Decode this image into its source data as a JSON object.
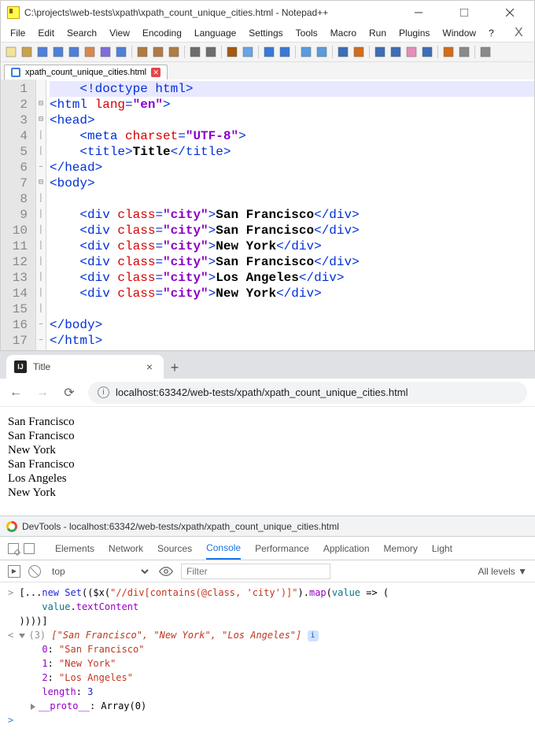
{
  "notepadpp": {
    "title": "C:\\projects\\web-tests\\xpath\\xpath_count_unique_cities.html - Notepad++",
    "menu": [
      "File",
      "Edit",
      "Search",
      "View",
      "Encoding",
      "Language",
      "Settings",
      "Tools",
      "Macro",
      "Run",
      "Plugins",
      "Window",
      "?"
    ],
    "extra_close": "X",
    "tab": {
      "name": "xpath_count_unique_cities.html"
    },
    "code": {
      "lines": [
        {
          "n": 1,
          "hl": true,
          "fold": "",
          "tokens": [
            {
              "txt": "    ",
              "cls": ""
            },
            {
              "txt": "<!doctype html>",
              "cls": "c-blue"
            }
          ]
        },
        {
          "n": 2,
          "fold": "⊟",
          "tokens": [
            {
              "txt": "<html ",
              "cls": "c-blue"
            },
            {
              "txt": "lang",
              "cls": "c-red"
            },
            {
              "txt": "=",
              "cls": "c-blue"
            },
            {
              "txt": "\"en\"",
              "cls": "c-purple bold"
            },
            {
              "txt": ">",
              "cls": "c-blue"
            }
          ]
        },
        {
          "n": 3,
          "fold": "⊟",
          "tokens": [
            {
              "txt": "<head>",
              "cls": "c-blue"
            }
          ]
        },
        {
          "n": 4,
          "fold": "│",
          "tokens": [
            {
              "txt": "    ",
              "cls": ""
            },
            {
              "txt": "<meta ",
              "cls": "c-blue"
            },
            {
              "txt": "charset",
              "cls": "c-red"
            },
            {
              "txt": "=",
              "cls": "c-blue"
            },
            {
              "txt": "\"UTF-8\"",
              "cls": "c-purple bold"
            },
            {
              "txt": ">",
              "cls": "c-blue"
            }
          ]
        },
        {
          "n": 5,
          "fold": "│",
          "tokens": [
            {
              "txt": "    ",
              "cls": ""
            },
            {
              "txt": "<title>",
              "cls": "c-blue"
            },
            {
              "txt": "Title",
              "cls": "c-black bold"
            },
            {
              "txt": "</title>",
              "cls": "c-blue"
            }
          ]
        },
        {
          "n": 6,
          "fold": "–",
          "tokens": [
            {
              "txt": "</head>",
              "cls": "c-blue"
            }
          ]
        },
        {
          "n": 7,
          "fold": "⊟",
          "tokens": [
            {
              "txt": "<body>",
              "cls": "c-blue"
            }
          ]
        },
        {
          "n": 8,
          "fold": "│",
          "tokens": [
            {
              "txt": "",
              "cls": ""
            }
          ]
        },
        {
          "n": 9,
          "fold": "│",
          "tokens": [
            {
              "txt": "    ",
              "cls": ""
            },
            {
              "txt": "<div ",
              "cls": "c-blue"
            },
            {
              "txt": "class",
              "cls": "c-red"
            },
            {
              "txt": "=",
              "cls": "c-blue"
            },
            {
              "txt": "\"city\"",
              "cls": "c-purple bold"
            },
            {
              "txt": ">",
              "cls": "c-blue"
            },
            {
              "txt": "San Francisco",
              "cls": "c-black bold"
            },
            {
              "txt": "</div>",
              "cls": "c-blue"
            }
          ]
        },
        {
          "n": 10,
          "fold": "│",
          "tokens": [
            {
              "txt": "    ",
              "cls": ""
            },
            {
              "txt": "<div ",
              "cls": "c-blue"
            },
            {
              "txt": "class",
              "cls": "c-red"
            },
            {
              "txt": "=",
              "cls": "c-blue"
            },
            {
              "txt": "\"city\"",
              "cls": "c-purple bold"
            },
            {
              "txt": ">",
              "cls": "c-blue"
            },
            {
              "txt": "San Francisco",
              "cls": "c-black bold"
            },
            {
              "txt": "</div>",
              "cls": "c-blue"
            }
          ]
        },
        {
          "n": 11,
          "fold": "│",
          "tokens": [
            {
              "txt": "    ",
              "cls": ""
            },
            {
              "txt": "<div ",
              "cls": "c-blue"
            },
            {
              "txt": "class",
              "cls": "c-red"
            },
            {
              "txt": "=",
              "cls": "c-blue"
            },
            {
              "txt": "\"city\"",
              "cls": "c-purple bold"
            },
            {
              "txt": ">",
              "cls": "c-blue"
            },
            {
              "txt": "New York",
              "cls": "c-black bold"
            },
            {
              "txt": "</div>",
              "cls": "c-blue"
            }
          ]
        },
        {
          "n": 12,
          "fold": "│",
          "tokens": [
            {
              "txt": "    ",
              "cls": ""
            },
            {
              "txt": "<div ",
              "cls": "c-blue"
            },
            {
              "txt": "class",
              "cls": "c-red"
            },
            {
              "txt": "=",
              "cls": "c-blue"
            },
            {
              "txt": "\"city\"",
              "cls": "c-purple bold"
            },
            {
              "txt": ">",
              "cls": "c-blue"
            },
            {
              "txt": "San Francisco",
              "cls": "c-black bold"
            },
            {
              "txt": "</div>",
              "cls": "c-blue"
            }
          ]
        },
        {
          "n": 13,
          "fold": "│",
          "tokens": [
            {
              "txt": "    ",
              "cls": ""
            },
            {
              "txt": "<div ",
              "cls": "c-blue"
            },
            {
              "txt": "class",
              "cls": "c-red"
            },
            {
              "txt": "=",
              "cls": "c-blue"
            },
            {
              "txt": "\"city\"",
              "cls": "c-purple bold"
            },
            {
              "txt": ">",
              "cls": "c-blue"
            },
            {
              "txt": "Los Angeles",
              "cls": "c-black bold"
            },
            {
              "txt": "</div>",
              "cls": "c-blue"
            }
          ]
        },
        {
          "n": 14,
          "fold": "│",
          "tokens": [
            {
              "txt": "    ",
              "cls": ""
            },
            {
              "txt": "<div ",
              "cls": "c-blue"
            },
            {
              "txt": "class",
              "cls": "c-red"
            },
            {
              "txt": "=",
              "cls": "c-blue"
            },
            {
              "txt": "\"city\"",
              "cls": "c-purple bold"
            },
            {
              "txt": ">",
              "cls": "c-blue"
            },
            {
              "txt": "New York",
              "cls": "c-black bold"
            },
            {
              "txt": "</div>",
              "cls": "c-blue"
            }
          ]
        },
        {
          "n": 15,
          "fold": "│",
          "tokens": [
            {
              "txt": "",
              "cls": ""
            }
          ]
        },
        {
          "n": 16,
          "fold": "–",
          "tokens": [
            {
              "txt": "</body>",
              "cls": "c-blue"
            }
          ]
        },
        {
          "n": 17,
          "fold": "–",
          "tokens": [
            {
              "txt": "</html>",
              "cls": "c-blue"
            }
          ]
        }
      ]
    }
  },
  "browser": {
    "tab_title": "Title",
    "url": "localhost:63342/web-tests/xpath/xpath_count_unique_cities.html",
    "page_lines": [
      "San Francisco",
      "San Francisco",
      "New York",
      "San Francisco",
      "Los Angeles",
      "New York"
    ]
  },
  "devtools": {
    "title": "DevTools - localhost:63342/web-tests/xpath/xpath_count_unique_cities.html",
    "tabs": [
      "Elements",
      "Network",
      "Sources",
      "Console",
      "Performance",
      "Application",
      "Memory",
      "Light"
    ],
    "active_tab": "Console",
    "context": "top",
    "filter_placeholder": "Filter",
    "levels": "All levels ▼",
    "console": {
      "input_lines": [
        "[...new Set(($x(\"//div[contains(@class, 'city')]\").map(value => (",
        "    value.textContent",
        "))))]"
      ],
      "result_header_prefix": "(3) ",
      "result_header_array": "[\"San Francisco\", \"New York\", \"Los Angeles\"]",
      "items": [
        {
          "idx": "0",
          "val": "\"San Francisco\""
        },
        {
          "idx": "1",
          "val": "\"New York\""
        },
        {
          "idx": "2",
          "val": "\"Los Angeles\""
        }
      ],
      "length_label": "length",
      "length_val": "3",
      "proto_label": "__proto__",
      "proto_val": "Array(0)"
    }
  }
}
